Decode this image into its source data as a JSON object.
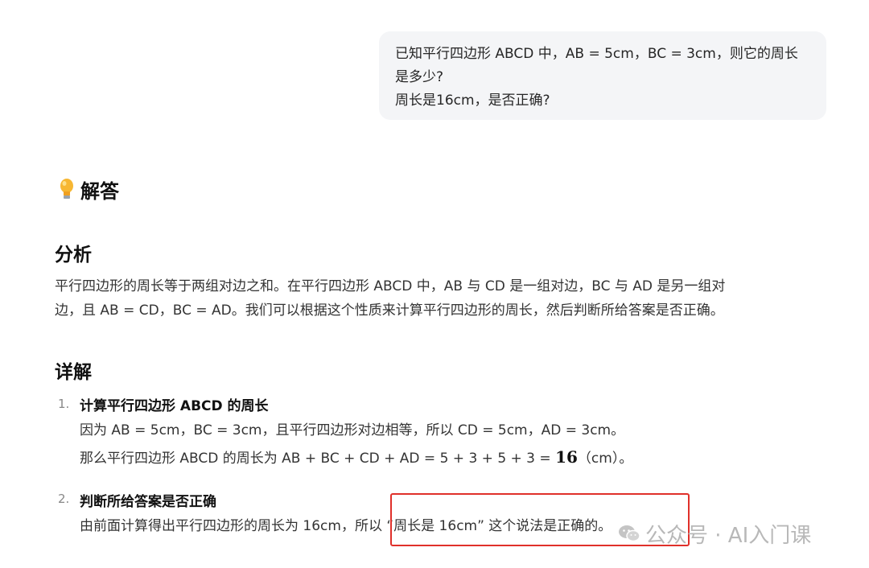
{
  "user_message": {
    "line1": "已知平行四边形 ABCD 中，AB = 5cm，BC = 3cm，则它的周长",
    "line2": "是多少?",
    "line3": "周长是16cm，是否正确?"
  },
  "answer": {
    "icon": "lightbulb-icon",
    "title": "解答"
  },
  "analysis": {
    "title": "分析",
    "line1": "平行四边形的周长等于两组对边之和。在平行四边形 ABCD 中，AB 与 CD 是一组对边，BC 与 AD 是另一组对",
    "line2": "边，且 AB = CD，BC = AD。我们可以根据这个性质来计算平行四边形的周长，然后判断所给答案是否正确。"
  },
  "details": {
    "title": "详解",
    "items": [
      {
        "num": "1.",
        "title": "计算平行四边形 ABCD 的周长",
        "text1": "因为 AB = 5cm，BC = 3cm，且平行四边形对边相等，所以 CD = 5cm，AD = 3cm。",
        "text2_prefix": "那么平行四边形 ABCD 的周长为 AB + BC + CD + AD = 5 + 3 + 5 + 3 = ",
        "text2_value": "16",
        "text2_suffix": "（cm）。"
      },
      {
        "num": "2.",
        "title": "判断所给答案是否正确",
        "text1": "由前面计算得出平行四边形的周长为 16cm，所以 “周长是 16cm” 这个说法是正确的。"
      }
    ]
  },
  "watermark": {
    "icon": "wechat-icon",
    "text": "公众号 · AI入门课"
  },
  "colors": {
    "bubble_bg": "#f4f5f7",
    "highlight_border": "#e0302a",
    "watermark": "#b8b8b8"
  }
}
